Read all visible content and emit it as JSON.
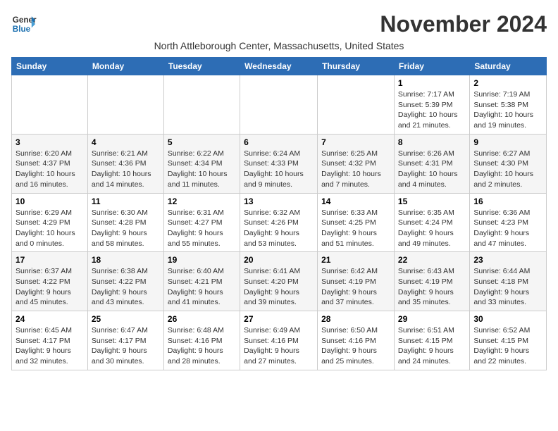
{
  "header": {
    "logo_line1": "General",
    "logo_line2": "Blue",
    "month_title": "November 2024",
    "subtitle": "North Attleborough Center, Massachusetts, United States"
  },
  "days_of_week": [
    "Sunday",
    "Monday",
    "Tuesday",
    "Wednesday",
    "Thursday",
    "Friday",
    "Saturday"
  ],
  "weeks": [
    [
      {
        "day": "",
        "info": ""
      },
      {
        "day": "",
        "info": ""
      },
      {
        "day": "",
        "info": ""
      },
      {
        "day": "",
        "info": ""
      },
      {
        "day": "",
        "info": ""
      },
      {
        "day": "1",
        "info": "Sunrise: 7:17 AM\nSunset: 5:39 PM\nDaylight: 10 hours and 21 minutes."
      },
      {
        "day": "2",
        "info": "Sunrise: 7:19 AM\nSunset: 5:38 PM\nDaylight: 10 hours and 19 minutes."
      }
    ],
    [
      {
        "day": "3",
        "info": "Sunrise: 6:20 AM\nSunset: 4:37 PM\nDaylight: 10 hours and 16 minutes."
      },
      {
        "day": "4",
        "info": "Sunrise: 6:21 AM\nSunset: 4:36 PM\nDaylight: 10 hours and 14 minutes."
      },
      {
        "day": "5",
        "info": "Sunrise: 6:22 AM\nSunset: 4:34 PM\nDaylight: 10 hours and 11 minutes."
      },
      {
        "day": "6",
        "info": "Sunrise: 6:24 AM\nSunset: 4:33 PM\nDaylight: 10 hours and 9 minutes."
      },
      {
        "day": "7",
        "info": "Sunrise: 6:25 AM\nSunset: 4:32 PM\nDaylight: 10 hours and 7 minutes."
      },
      {
        "day": "8",
        "info": "Sunrise: 6:26 AM\nSunset: 4:31 PM\nDaylight: 10 hours and 4 minutes."
      },
      {
        "day": "9",
        "info": "Sunrise: 6:27 AM\nSunset: 4:30 PM\nDaylight: 10 hours and 2 minutes."
      }
    ],
    [
      {
        "day": "10",
        "info": "Sunrise: 6:29 AM\nSunset: 4:29 PM\nDaylight: 10 hours and 0 minutes."
      },
      {
        "day": "11",
        "info": "Sunrise: 6:30 AM\nSunset: 4:28 PM\nDaylight: 9 hours and 58 minutes."
      },
      {
        "day": "12",
        "info": "Sunrise: 6:31 AM\nSunset: 4:27 PM\nDaylight: 9 hours and 55 minutes."
      },
      {
        "day": "13",
        "info": "Sunrise: 6:32 AM\nSunset: 4:26 PM\nDaylight: 9 hours and 53 minutes."
      },
      {
        "day": "14",
        "info": "Sunrise: 6:33 AM\nSunset: 4:25 PM\nDaylight: 9 hours and 51 minutes."
      },
      {
        "day": "15",
        "info": "Sunrise: 6:35 AM\nSunset: 4:24 PM\nDaylight: 9 hours and 49 minutes."
      },
      {
        "day": "16",
        "info": "Sunrise: 6:36 AM\nSunset: 4:23 PM\nDaylight: 9 hours and 47 minutes."
      }
    ],
    [
      {
        "day": "17",
        "info": "Sunrise: 6:37 AM\nSunset: 4:22 PM\nDaylight: 9 hours and 45 minutes."
      },
      {
        "day": "18",
        "info": "Sunrise: 6:38 AM\nSunset: 4:22 PM\nDaylight: 9 hours and 43 minutes."
      },
      {
        "day": "19",
        "info": "Sunrise: 6:40 AM\nSunset: 4:21 PM\nDaylight: 9 hours and 41 minutes."
      },
      {
        "day": "20",
        "info": "Sunrise: 6:41 AM\nSunset: 4:20 PM\nDaylight: 9 hours and 39 minutes."
      },
      {
        "day": "21",
        "info": "Sunrise: 6:42 AM\nSunset: 4:19 PM\nDaylight: 9 hours and 37 minutes."
      },
      {
        "day": "22",
        "info": "Sunrise: 6:43 AM\nSunset: 4:19 PM\nDaylight: 9 hours and 35 minutes."
      },
      {
        "day": "23",
        "info": "Sunrise: 6:44 AM\nSunset: 4:18 PM\nDaylight: 9 hours and 33 minutes."
      }
    ],
    [
      {
        "day": "24",
        "info": "Sunrise: 6:45 AM\nSunset: 4:17 PM\nDaylight: 9 hours and 32 minutes."
      },
      {
        "day": "25",
        "info": "Sunrise: 6:47 AM\nSunset: 4:17 PM\nDaylight: 9 hours and 30 minutes."
      },
      {
        "day": "26",
        "info": "Sunrise: 6:48 AM\nSunset: 4:16 PM\nDaylight: 9 hours and 28 minutes."
      },
      {
        "day": "27",
        "info": "Sunrise: 6:49 AM\nSunset: 4:16 PM\nDaylight: 9 hours and 27 minutes."
      },
      {
        "day": "28",
        "info": "Sunrise: 6:50 AM\nSunset: 4:16 PM\nDaylight: 9 hours and 25 minutes."
      },
      {
        "day": "29",
        "info": "Sunrise: 6:51 AM\nSunset: 4:15 PM\nDaylight: 9 hours and 24 minutes."
      },
      {
        "day": "30",
        "info": "Sunrise: 6:52 AM\nSunset: 4:15 PM\nDaylight: 9 hours and 22 minutes."
      }
    ]
  ]
}
